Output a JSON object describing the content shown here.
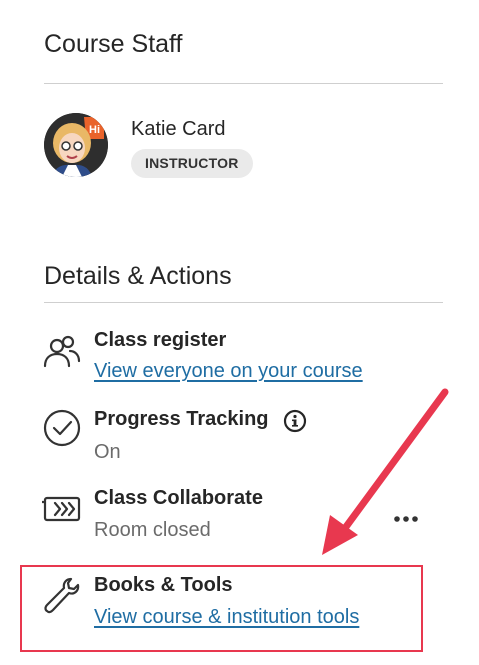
{
  "course_staff": {
    "heading": "Course Staff",
    "members": [
      {
        "name": "Katie Card",
        "role": "INSTRUCTOR",
        "avatar_badge": "Hi"
      }
    ]
  },
  "details_actions": {
    "heading": "Details & Actions",
    "items": [
      {
        "icon": "class-register-icon",
        "title": "Class register",
        "link": "View everyone on your course"
      },
      {
        "icon": "progress-tracking-icon",
        "title": "Progress Tracking",
        "status": "On",
        "extra_icon": "info-icon"
      },
      {
        "icon": "video-camera-icon",
        "title": "Class Collaborate",
        "status": "Room closed",
        "menu": "more-options"
      },
      {
        "icon": "wrench-icon",
        "title": "Books & Tools",
        "link": "View course & institution tools"
      }
    ]
  },
  "colors": {
    "link": "#1f6da3",
    "annotation": "#e8384f",
    "badge_bg": "#eaeaea"
  }
}
